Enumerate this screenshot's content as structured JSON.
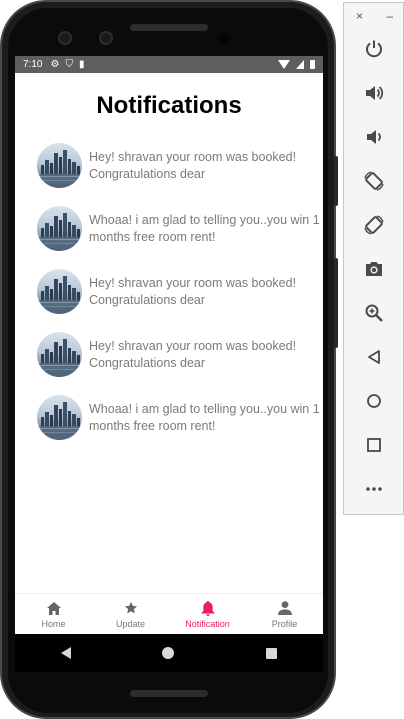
{
  "status_bar": {
    "time": "7:10"
  },
  "page": {
    "title": "Notifications"
  },
  "notifications": [
    {
      "text": "Hey! shravan your room was booked! Congratulations dear"
    },
    {
      "text": "Whoaa! i am glad to telling you..you win 1 months free room rent!"
    },
    {
      "text": "Hey! shravan your room was booked! Congratulations dear"
    },
    {
      "text": "Hey! shravan your room was booked! Congratulations dear"
    },
    {
      "text": "Whoaa! i am glad to telling you..you win 1 months free room rent!"
    }
  ],
  "bottom_nav": {
    "active": "Notification",
    "active_color": "#e91e63",
    "items": [
      {
        "label": "Home",
        "icon": "home-icon"
      },
      {
        "label": "Update",
        "icon": "star-icon"
      },
      {
        "label": "Notification",
        "icon": "bell-icon"
      },
      {
        "label": "Profile",
        "icon": "person-icon"
      }
    ]
  },
  "emulator_panel": {
    "window_controls": {
      "close": "×",
      "minimize": "–"
    },
    "tools": [
      "power-icon",
      "volume-up-icon",
      "volume-down-icon",
      "rotate-left-icon",
      "rotate-right-icon",
      "camera-icon",
      "zoom-icon",
      "back-icon",
      "home-circle-icon",
      "overview-square-icon",
      "more-icon"
    ]
  }
}
